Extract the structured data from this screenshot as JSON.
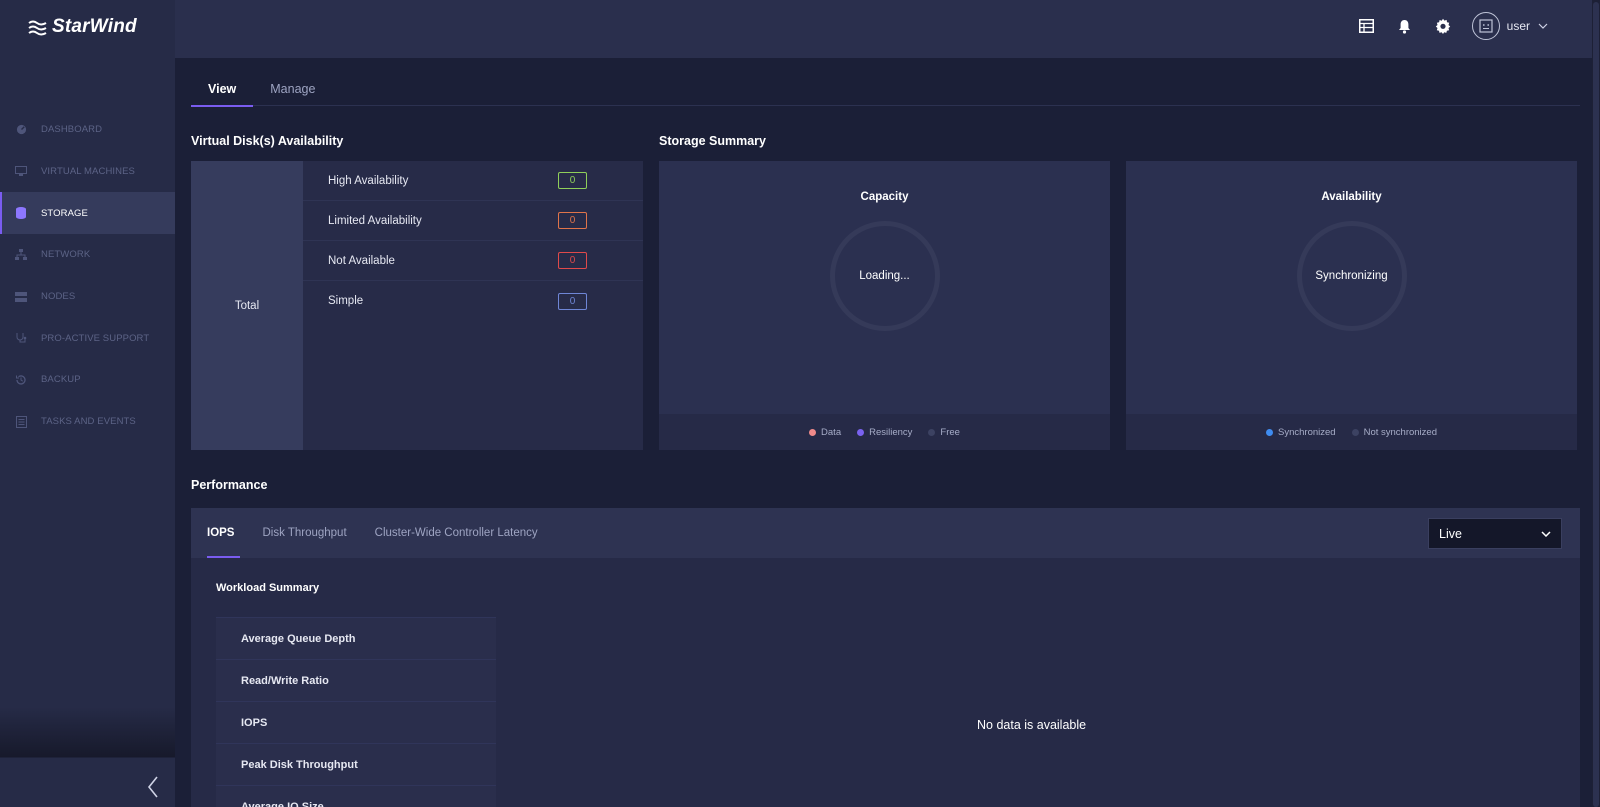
{
  "brand": {
    "name": "StarWind"
  },
  "sidebar": {
    "items": [
      {
        "label": "DASHBOARD",
        "icon": "dashboard-icon",
        "active": false
      },
      {
        "label": "VIRTUAL MACHINES",
        "icon": "monitor-icon",
        "active": false
      },
      {
        "label": "STORAGE",
        "icon": "database-icon",
        "active": true
      },
      {
        "label": "NETWORK",
        "icon": "network-icon",
        "active": false
      },
      {
        "label": "NODES",
        "icon": "server-icon",
        "active": false
      },
      {
        "label": "PRO-ACTIVE SUPPORT",
        "icon": "stethoscope-icon",
        "active": false
      },
      {
        "label": "BACKUP",
        "icon": "history-icon",
        "active": false
      },
      {
        "label": "TASKS AND EVENTS",
        "icon": "list-icon",
        "active": false
      }
    ]
  },
  "header": {
    "icons": [
      "table-icon",
      "bell-icon",
      "gear-icon"
    ],
    "user": {
      "name": "user"
    }
  },
  "tabs": [
    {
      "label": "View",
      "active": true
    },
    {
      "label": "Manage",
      "active": false
    }
  ],
  "vda": {
    "title": "Virtual Disk(s) Availability",
    "total_label": "Total",
    "rows": [
      {
        "label": "High Availability",
        "value": "0",
        "color": "#8fcf5a"
      },
      {
        "label": "Limited Availability",
        "value": "0",
        "color": "#e0744a"
      },
      {
        "label": "Not Available",
        "value": "0",
        "color": "#e04a4a"
      },
      {
        "label": "Simple",
        "value": "0",
        "color": "#6f86d6"
      }
    ]
  },
  "storage_summary": {
    "title": "Storage Summary",
    "capacity": {
      "title": "Capacity",
      "status": "Loading...",
      "legend": [
        {
          "label": "Data",
          "color": "#f08a8a"
        },
        {
          "label": "Resiliency",
          "color": "#7a62f0"
        },
        {
          "label": "Free",
          "color": "#3c4262"
        }
      ]
    },
    "availability": {
      "title": "Availability",
      "status": "Synchronizing",
      "legend": [
        {
          "label": "Synchronized",
          "color": "#3f8cf0"
        },
        {
          "label": "Not synchronized",
          "color": "#3c4262"
        }
      ]
    }
  },
  "performance": {
    "title": "Performance",
    "tabs": [
      {
        "label": "IOPS",
        "active": true
      },
      {
        "label": "Disk Throughput",
        "active": false
      },
      {
        "label": "Cluster-Wide Controller Latency",
        "active": false
      }
    ],
    "range_select": "Live",
    "workload_title": "Workload Summary",
    "workload_rows": [
      "Average Queue Depth",
      "Read/Write Ratio",
      "IOPS",
      "Peak Disk Throughput",
      "Average IO Size"
    ],
    "no_data": "No data is available"
  }
}
